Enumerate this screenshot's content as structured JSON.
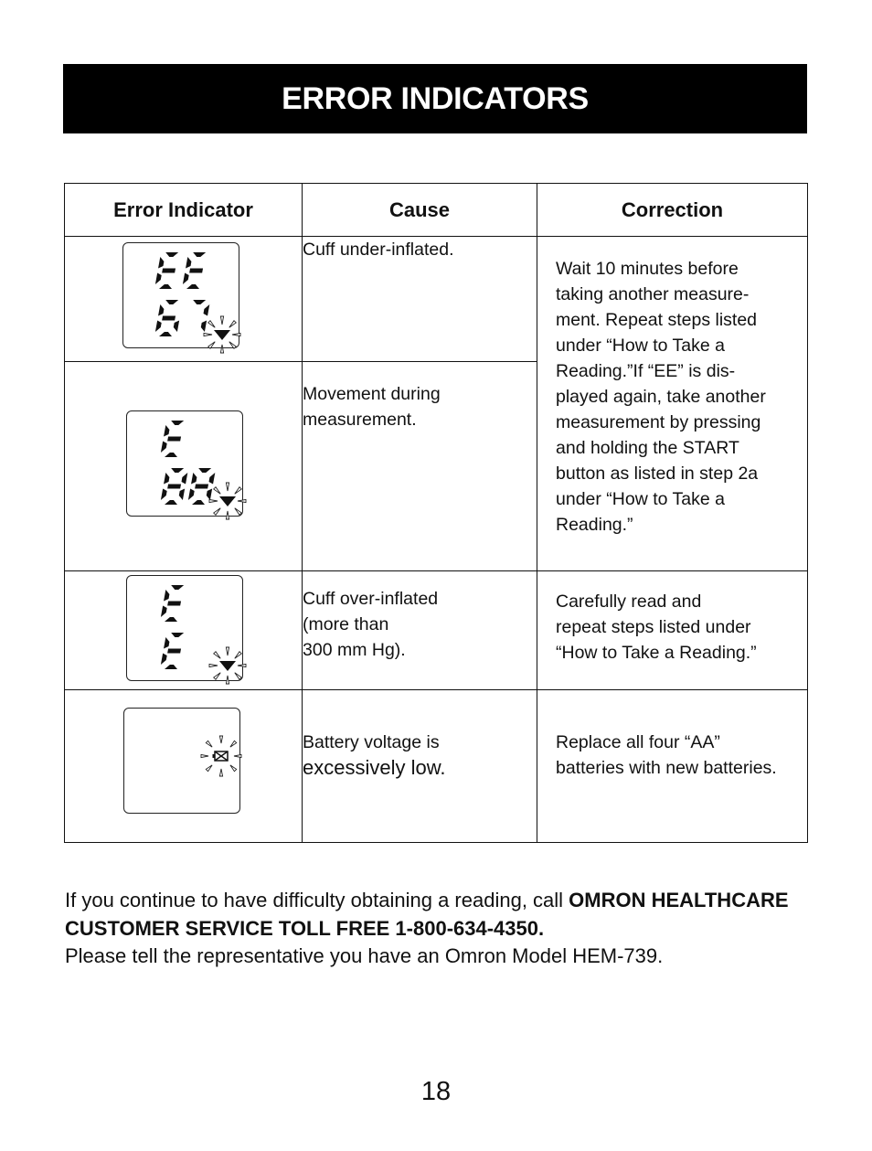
{
  "page": {
    "title": "ERROR INDICATORS",
    "page_number": "18"
  },
  "table": {
    "headers": [
      "Error Indicator",
      "Cause",
      "Correction"
    ],
    "rows": [
      {
        "display": {
          "line1": "EE",
          "line2": "67",
          "icon": "flashing-heart-icon"
        },
        "cause": "Cuff under-inflated.",
        "correction": "Wait 10 minutes before taking another measure-ment. Repeat steps listed under “How to Take a Reading.”If “EE” is dis-played again, take another measurement by pressing and holding the START button as listed in step 2a under “How to Take a Reading.”"
      },
      {
        "display": {
          "line1": "E",
          "line2": "88",
          "icon": "flashing-heart-icon"
        },
        "cause": "Movement during measurement.",
        "correction_shared_with_row": 0
      },
      {
        "display": {
          "line1": "E",
          "line2": "E",
          "icon": "flashing-heart-icon"
        },
        "cause": "Cuff over-inflated (more than 300 mm Hg).",
        "correction": "Carefully read and repeat steps listed under “How to Take a Reading.”"
      },
      {
        "display": {
          "line1": "",
          "line2": "",
          "icon": "flashing-low-battery-icon"
        },
        "cause_line1": "Battery voltage is",
        "cause_line2": "excessively low.",
        "correction": "Replace all four “AA” batteries with new batteries."
      }
    ],
    "correction_lines": {
      "row0": [
        "Wait 10 minutes before",
        "taking another measure-",
        "ment. Repeat steps listed",
        "under “How to Take a",
        "Reading.”If “EE” is dis-",
        "played again, take another",
        "measurement by pressing",
        "and holding the START",
        "button as listed in step 2a",
        "under “How to Take a",
        "Reading.”"
      ],
      "row2": [
        "Carefully read and",
        "repeat steps listed under",
        "“How to Take a Reading.”"
      ],
      "row3": [
        "Replace all four “AA”",
        "batteries with new batteries."
      ]
    },
    "cause_lines": {
      "row0": [
        "Cuff under-inflated."
      ],
      "row1": [
        "Movement during",
        "measurement."
      ],
      "row2": [
        "Cuff over-inflated",
        "(more than",
        "300 mm Hg)."
      ]
    }
  },
  "footer": {
    "text_before_bold": "If you continue to have difficulty obtaining a reading, call ",
    "bold_text": "OMRON HEALTHCARE CUSTOMER SERVICE TOLL FREE 1-800-634-4350.",
    "text_after_bold": "Please tell the representative you have an Omron Model HEM-739."
  }
}
